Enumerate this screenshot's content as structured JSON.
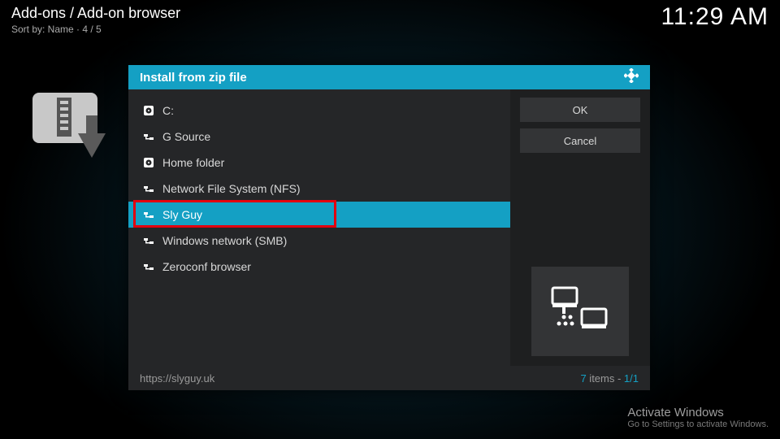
{
  "header": {
    "breadcrumb": "Add-ons / Add-on browser",
    "sort_by": "Sort by: Name  ·  4 / 5",
    "clock": "11:29 AM"
  },
  "dialog": {
    "title": "Install from zip file",
    "items": [
      {
        "icon": "drive",
        "label": "C:"
      },
      {
        "icon": "net",
        "label": "G Source"
      },
      {
        "icon": "drive",
        "label": "Home folder"
      },
      {
        "icon": "net",
        "label": "Network File System (NFS)"
      },
      {
        "icon": "net",
        "label": "Sly Guy",
        "selected": true,
        "highlighted": true
      },
      {
        "icon": "net",
        "label": "Windows network (SMB)"
      },
      {
        "icon": "net",
        "label": "Zeroconf browser"
      }
    ],
    "buttons": {
      "ok": "OK",
      "cancel": "Cancel"
    },
    "footer_path": "https://slyguy.uk",
    "footer_count_num": "7",
    "footer_count_rest": " items - ",
    "footer_page": "1/1"
  },
  "watermark": {
    "title": "Activate Windows",
    "sub": "Go to Settings to activate Windows."
  }
}
